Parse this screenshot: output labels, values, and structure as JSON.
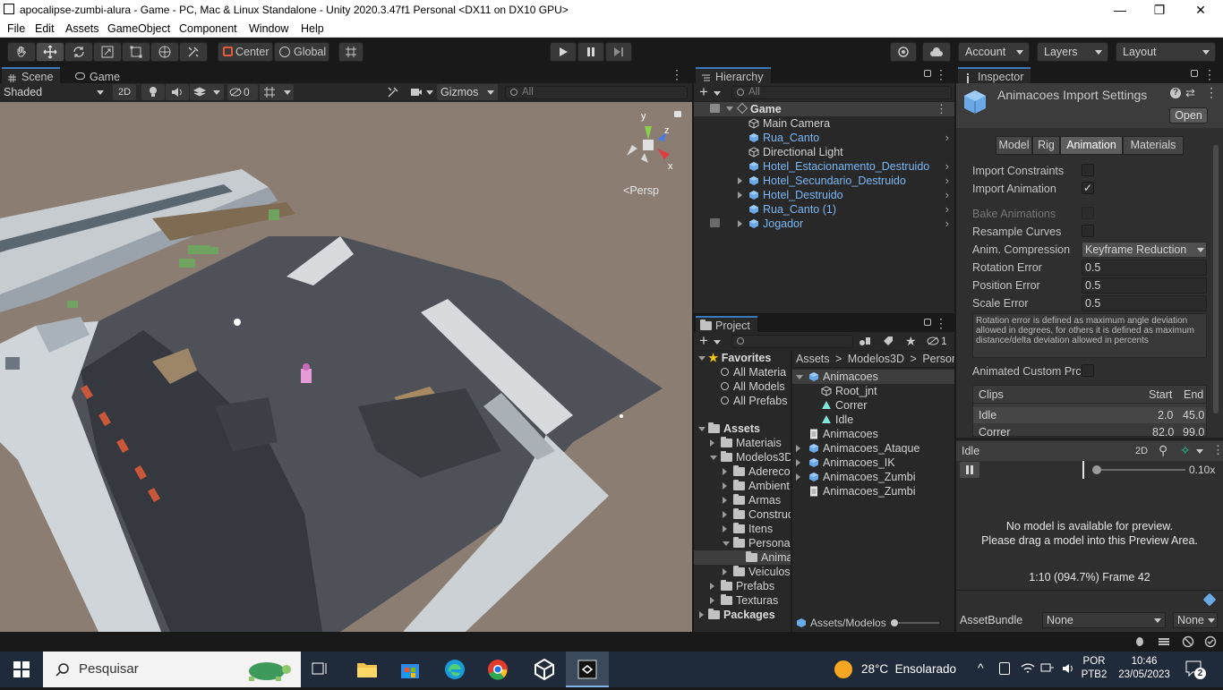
{
  "window": {
    "title": "apocalipse-zumbi-alura - Game - PC, Mac & Linux Standalone - Unity 2020.3.47f1 Personal <DX11 on DX10 GPU>",
    "minimize": "—",
    "maximize": "❐",
    "close": "✕"
  },
  "menu": [
    "File",
    "Edit",
    "Assets",
    "GameObject",
    "Component",
    "Window",
    "Help"
  ],
  "toolbar": {
    "center_label": "Center",
    "global_label": "Global",
    "account_label": "Account",
    "layers_label": "Layers",
    "layout_label": "Layout"
  },
  "scene": {
    "tab_scene": "Scene",
    "tab_game": "Game",
    "shading": "Shaded",
    "mode_2d": "2D",
    "hidden_count": "0",
    "gizmos": "Gizmos",
    "search_placeholder": "All",
    "gizmo_y": "y",
    "gizmo_z": "z",
    "gizmo_x": "x",
    "persp": "Persp"
  },
  "hierarchy": {
    "tab": "Hierarchy",
    "search_placeholder": "All",
    "scene_name": "Game",
    "items": [
      {
        "label": "Main Camera",
        "prefab": false,
        "expandable": false
      },
      {
        "label": "Rua_Canto",
        "prefab": true,
        "expandable": false
      },
      {
        "label": "Directional Light",
        "prefab": false,
        "expandable": false
      },
      {
        "label": "Hotel_Estacionamento_Destruido",
        "prefab": true,
        "expandable": false
      },
      {
        "label": "Hotel_Secundario_Destruido",
        "prefab": true,
        "expandable": true
      },
      {
        "label": "Hotel_Destruido",
        "prefab": true,
        "expandable": true
      },
      {
        "label": "Rua_Canto (1)",
        "prefab": true,
        "expandable": false
      },
      {
        "label": "Jogador",
        "prefab": true,
        "expandable": true
      }
    ]
  },
  "project": {
    "tab": "Project",
    "hidden_count": "1",
    "favorites_label": "Favorites",
    "favorites": [
      "All Materia",
      "All Models",
      "All Prefabs"
    ],
    "assets_label": "Assets",
    "tree": [
      {
        "label": "Materiais",
        "indent": 1
      },
      {
        "label": "Modelos3D",
        "indent": 1
      },
      {
        "label": "Adereco",
        "indent": 2
      },
      {
        "label": "Ambient",
        "indent": 2
      },
      {
        "label": "Armas",
        "indent": 2
      },
      {
        "label": "Construc",
        "indent": 2
      },
      {
        "label": "Itens",
        "indent": 2
      },
      {
        "label": "Persona",
        "indent": 2
      },
      {
        "label": "Anima",
        "indent": 3
      },
      {
        "label": "Veiculos",
        "indent": 2
      },
      {
        "label": "Prefabs",
        "indent": 1
      },
      {
        "label": "Texturas",
        "indent": 1
      }
    ],
    "packages_label": "Packages",
    "breadcrumb": [
      "Assets",
      "Modelos3D",
      "Person"
    ],
    "files": [
      {
        "label": "Animacoes",
        "icon": "model",
        "indent": 0
      },
      {
        "label": "Root_jnt",
        "icon": "bone",
        "indent": 1
      },
      {
        "label": "Correr",
        "icon": "clip",
        "indent": 1
      },
      {
        "label": "Idle",
        "icon": "clip",
        "indent": 1
      },
      {
        "label": "Animacoes",
        "icon": "doc",
        "indent": 0
      },
      {
        "label": "Animacoes_Ataque",
        "icon": "model",
        "indent": 0
      },
      {
        "label": "Animacoes_IK",
        "icon": "model",
        "indent": 0
      },
      {
        "label": "Animacoes_Zumbi",
        "icon": "model",
        "indent": 0
      },
      {
        "label": "Animacoes_Zumbi",
        "icon": "doc",
        "indent": 0
      }
    ],
    "footer_path": "Assets/Modelos"
  },
  "inspector": {
    "tab": "Inspector",
    "title": "Animacoes Import Settings",
    "open_button": "Open",
    "tabs": [
      "Model",
      "Rig",
      "Animation",
      "Materials"
    ],
    "import_constraints": "Import Constraints",
    "import_animation": "Import Animation",
    "bake_animations": "Bake Animations",
    "resample_curves": "Resample Curves",
    "anim_compression_label": "Anim. Compression",
    "anim_compression_value": "Keyframe Reduction",
    "rotation_error_label": "Rotation Error",
    "rotation_error_value": "0.5",
    "position_error_label": "Position Error",
    "position_error_value": "0.5",
    "scale_error_label": "Scale Error",
    "scale_error_value": "0.5",
    "help_text": "Rotation error is defined as maximum angle deviation allowed in degrees, for others it is defined as maximum distance/delta deviation allowed in percents",
    "animated_custom": "Animated Custom Prc",
    "clips_header": "Clips",
    "start_header": "Start",
    "end_header": "End",
    "clips": [
      {
        "name": "Idle",
        "start": "2.0",
        "end": "45.0"
      },
      {
        "name": "Correr",
        "start": "82.0",
        "end": "99.0"
      }
    ],
    "preview_name": "Idle",
    "preview_2d": "2D",
    "preview_speed": "0.10x",
    "preview_msg1": "No model is available for preview.",
    "preview_msg2": "Please drag a model into this Preview Area.",
    "preview_frame": "1:10 (094.7%) Frame 42",
    "assetbundle_label": "AssetBundle",
    "assetbundle_value": "None",
    "variant_value": "None"
  },
  "taskbar": {
    "search_placeholder": "Pesquisar",
    "weather": "28°C  Ensolarado",
    "lang1": "POR",
    "lang2": "PTB2",
    "time": "10:46",
    "date": "23/05/2023",
    "notifications": "2"
  },
  "colors": {
    "accent": "#3a79bb",
    "prefab_blue": "#7ab8f6",
    "selection": "#2c5d87"
  }
}
